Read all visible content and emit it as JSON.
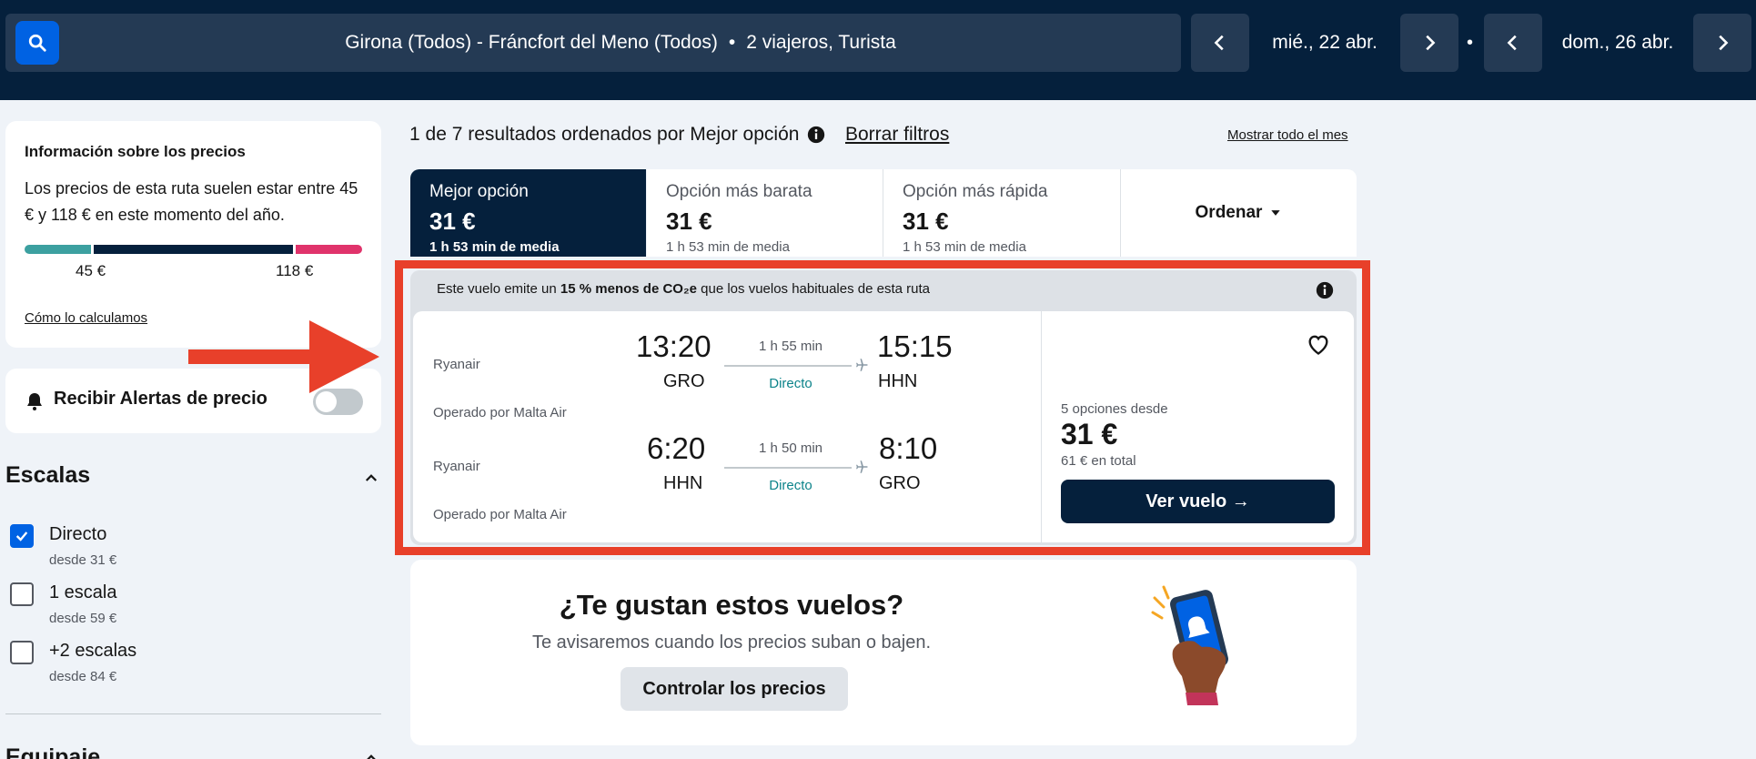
{
  "header": {
    "search_summary": "Girona (Todos) - Fráncfort del Meno (Todos)",
    "separator": "•",
    "travelers": "2 viajeros, Turista",
    "depart_date": "mié., 22 abr.",
    "date_separator": "•",
    "return_date": "dom., 26 abr."
  },
  "price_info": {
    "title": "Información sobre los precios",
    "text": "Los precios de esta ruta suelen estar entre 45 € y 118 € en este momento del año.",
    "low_label": "45 €",
    "high_label": "118 €",
    "how_link": "Cómo lo calculamos",
    "colors": {
      "low": "#3ca0a0",
      "mid": "#05203c",
      "high": "#e0336b"
    }
  },
  "alerts": {
    "label": "Recibir Alertas de precio",
    "toggle_on": false
  },
  "filters": {
    "stops_title": "Escalas",
    "options": [
      {
        "label": "Directo",
        "sub": "desde 31 €",
        "checked": true
      },
      {
        "label": "1 escala",
        "sub": "desde 59 €",
        "checked": false
      },
      {
        "label": "+2 escalas",
        "sub": "desde 84 €",
        "checked": false
      }
    ],
    "baggage_title": "Equipaje"
  },
  "results": {
    "summary": "1 de 7 resultados ordenados por Mejor opción",
    "clear_filters": "Borrar filtros",
    "show_month": "Mostrar todo el mes"
  },
  "sort_tabs": [
    {
      "label": "Mejor opción",
      "price": "31 €",
      "sub": "1 h 53 min de media",
      "active": true
    },
    {
      "label": "Opción más barata",
      "price": "31 €",
      "sub": "1 h 53 min de media",
      "active": false
    },
    {
      "label": "Opción más rápida",
      "price": "31 €",
      "sub": "1 h 53 min de media",
      "active": false
    }
  ],
  "sort_dropdown": "Ordenar",
  "eco_banner": {
    "prefix": "Este vuelo emite un",
    "highlight": "15 % menos de CO₂e",
    "suffix": "que los vuelos habituales de esta ruta"
  },
  "flight": {
    "legs": [
      {
        "airline": "Ryanair",
        "operated": "Operado por Malta Air",
        "dep_time": "13:20",
        "dep_code": "GRO",
        "duration": "1 h 55 min",
        "stops": "Directo",
        "arr_time": "15:15",
        "arr_code": "HHN"
      },
      {
        "airline": "Ryanair",
        "operated": "Operado por Malta Air",
        "dep_time": "6:20",
        "dep_code": "HHN",
        "duration": "1 h 50 min",
        "stops": "Directo",
        "arr_time": "8:10",
        "arr_code": "GRO"
      }
    ],
    "options_from": "5 opciones desde",
    "price": "31 €",
    "total": "61 € en total",
    "cta": "Ver vuelo →"
  },
  "promo": {
    "title": "¿Te gustan estos vuelos?",
    "text": "Te avisaremos cuando los precios suban o bajen.",
    "button": "Controlar los precios"
  },
  "annotation_color": "#e8402a"
}
